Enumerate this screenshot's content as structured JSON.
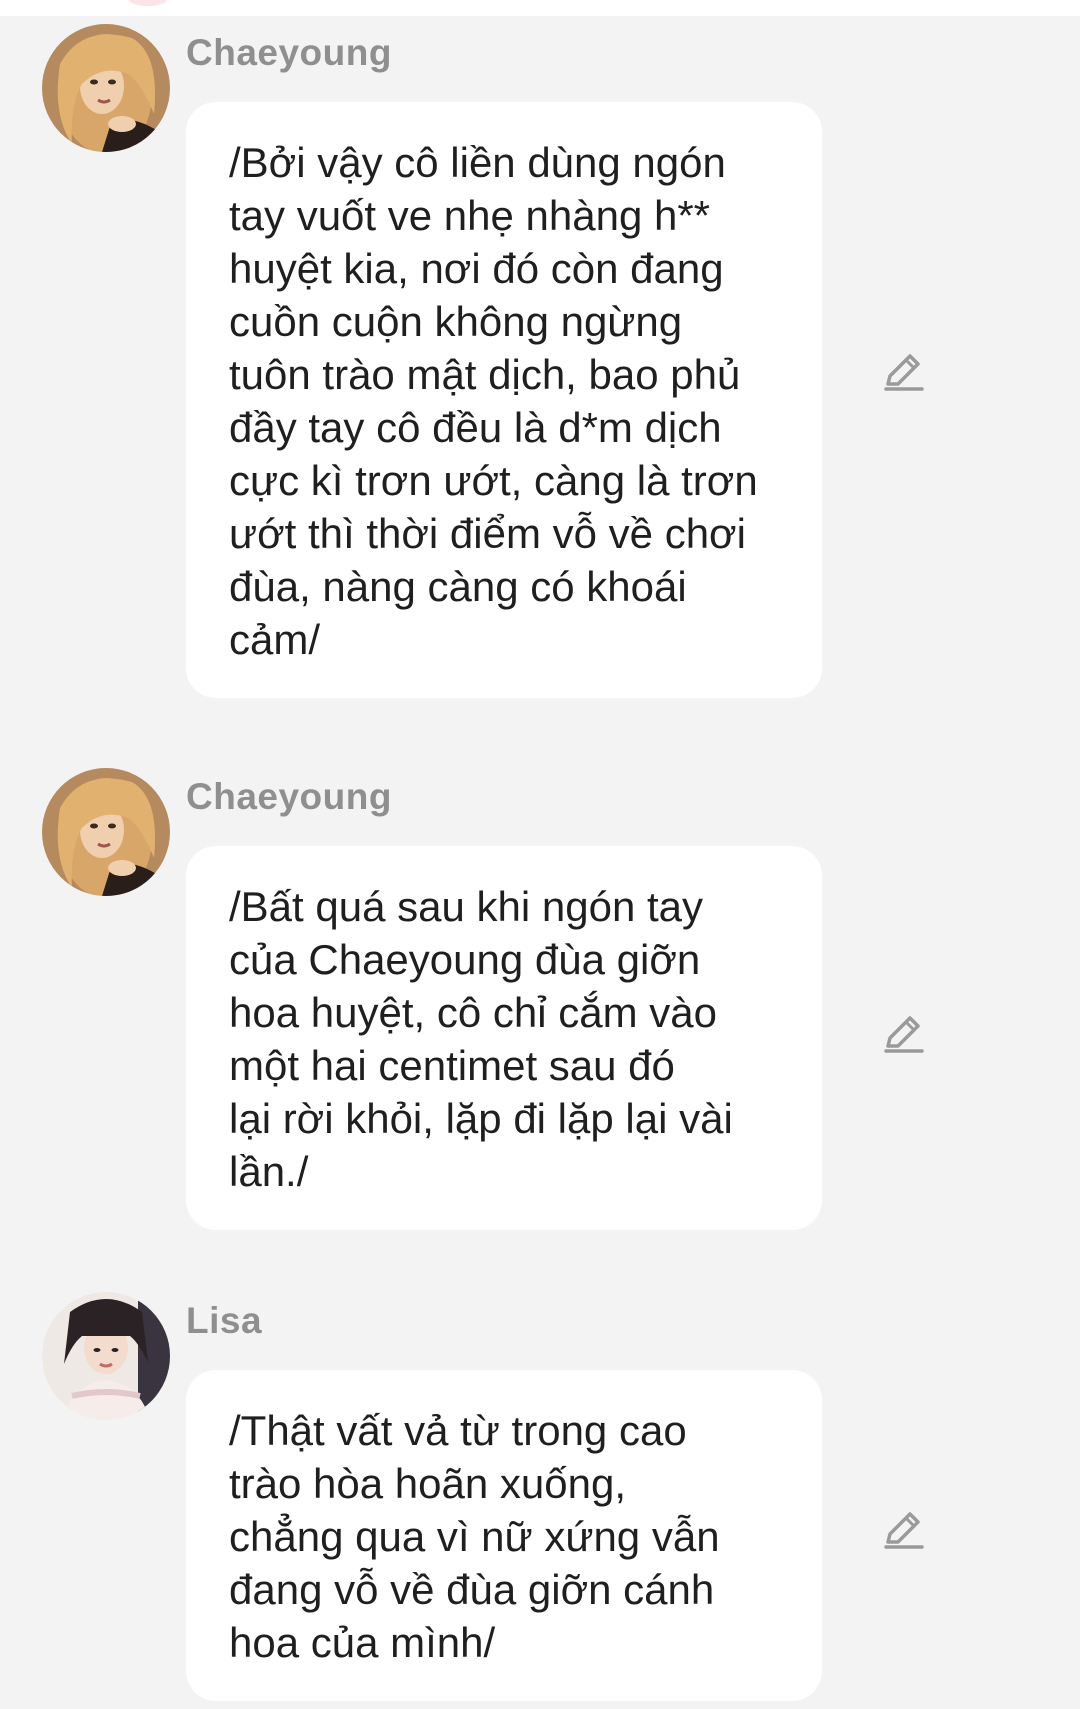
{
  "messages": [
    {
      "sender": "Chaeyoung",
      "avatar": "chaeyoung-avatar",
      "text": "/Bởi vậy cô liền dùng ngón\ntay vuốt ve nhẹ nhàng h**\nhuyệt kia, nơi đó còn đang\ncuồn cuộn không ngừng\ntuôn trào mật dịch, bao phủ\nđầy tay cô đều là d*m dịch\ncực kì trơn ướt, càng là trơn\nướt thì thời điểm vỗ về chơi\nđùa, nàng càng có khoái\ncảm/",
      "action_icon": "pencil-icon"
    },
    {
      "sender": "Chaeyoung",
      "avatar": "chaeyoung-avatar",
      "text": "/Bất quá sau khi ngón tay\ncủa Chaeyoung đùa giỡn\nhoa huyệt, cô chỉ cắm vào\nmột hai centimet sau đó\nlại rời khỏi, lặp đi lặp lại vài\nlần./",
      "action_icon": "pencil-icon"
    },
    {
      "sender": "Lisa",
      "avatar": "lisa-avatar",
      "text": "/Thật vất vả từ trong cao\ntrào hòa hoãn xuống,\nchẳng qua vì nữ xứng vẫn\nđang vỗ về đùa giỡn cánh\nhoa của mình/",
      "action_icon": "pencil-icon"
    }
  ],
  "colors": {
    "background": "#f4f3f3",
    "bubble": "#ffffff",
    "sender_name": "#8f8f8f",
    "message_text": "#1f1f1f",
    "icon": "#9a9a9a"
  }
}
